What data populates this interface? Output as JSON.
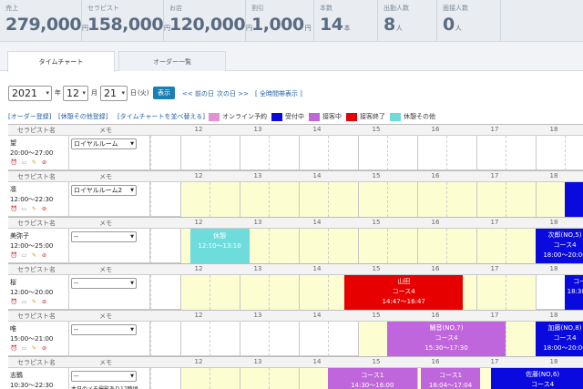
{
  "stats": [
    {
      "label": "売上",
      "value": "279,000",
      "unit": "円"
    },
    {
      "label": "セラピスト",
      "value": "158,000",
      "unit": "円"
    },
    {
      "label": "お店",
      "value": "120,000",
      "unit": "円"
    },
    {
      "label": "割引",
      "value": "1,000",
      "unit": "円"
    },
    {
      "label": "本数",
      "value": "14",
      "unit": "本"
    },
    {
      "label": "出勤人数",
      "value": "8",
      "unit": "人"
    },
    {
      "label": "面接人数",
      "value": "0",
      "unit": "人"
    }
  ],
  "tabs": {
    "timechart": "タイムチャート",
    "orders": "オーダー一覧"
  },
  "date": {
    "year": "2021",
    "year_suffix": "年",
    "month": "12",
    "month_suffix": "月",
    "day": "21",
    "day_suffix": "日",
    "weekday": "(火)",
    "show": "表示",
    "prev": "<< 前の日",
    "next": "次の日 >>",
    "all": "[ 全時間帯表示 ]"
  },
  "links": {
    "order_register": "[オーダー登録]",
    "break_register": "[休憩その他登録]",
    "sort": "[タイムチャートを並べ替える]"
  },
  "legend": [
    {
      "label": "オンライン予約",
      "color": "#e58fd6"
    },
    {
      "label": "受付中",
      "color": "#0a0adf"
    },
    {
      "label": "接客中",
      "color": "#c066dc"
    },
    {
      "label": "接客終了",
      "color": "#e60000"
    },
    {
      "label": "休憩その他",
      "color": "#6fdcdc"
    }
  ],
  "header": {
    "therapist": "セラピスト名",
    "memo": "メモ",
    "hours": [
      "12",
      "13",
      "14",
      "15",
      "16",
      "17",
      "18"
    ]
  },
  "rows": [
    {
      "name": "望",
      "time": "20:00〜27:00",
      "room": "ロイヤルルーム",
      "note": "",
      "avail": [],
      "blocks": []
    },
    {
      "name": "凛",
      "time": "12:00〜22:30",
      "room": "ロイヤルルーム2",
      "note": "",
      "avail": [
        [
          12,
          18.5
        ]
      ],
      "blocks": [
        {
          "s": 18.5,
          "e": 19,
          "color": "#0a0adf",
          "lines": []
        }
      ]
    },
    {
      "name": "美弥子",
      "time": "12:00〜25:00",
      "room": "--",
      "note": "",
      "avail": [
        [
          12,
          18
        ]
      ],
      "blocks": [
        {
          "s": 12.17,
          "e": 13.17,
          "color": "#6fdcdc",
          "lines": [
            "休憩",
            "12:10〜13:10"
          ]
        },
        {
          "s": 18,
          "e": 19,
          "color": "#0a0adf",
          "lines": [
            "次郎(NO,5)",
            "コース4",
            "18:00〜20:00"
          ]
        }
      ]
    },
    {
      "name": "桜",
      "time": "12:00〜20:00",
      "room": "--",
      "note": "",
      "avail": [
        [
          12,
          18
        ]
      ],
      "blocks": [
        {
          "s": 14.78,
          "e": 16.78,
          "color": "#e60000",
          "lines": [
            "山田",
            "コース4",
            "14:47〜16:47"
          ]
        },
        {
          "s": 18.5,
          "e": 19,
          "color": "#0a0adf",
          "lines": [
            "",
            "コー",
            "18:30〜"
          ]
        }
      ]
    },
    {
      "name": "唯",
      "time": "15:00〜21:00",
      "room": "--",
      "note": "",
      "avail": [
        [
          15,
          18
        ]
      ],
      "blocks": [
        {
          "s": 15.5,
          "e": 17.5,
          "color": "#c066dc",
          "lines": [
            "鯛音(NO,7)",
            "コース4",
            "15:30〜17:30"
          ]
        },
        {
          "s": 18,
          "e": 19,
          "color": "#0a0adf",
          "lines": [
            "加藤(NO,8)",
            "コース4",
            "18:00〜20:00"
          ]
        }
      ]
    },
    {
      "name": "志鶴",
      "time": "10:30〜22:30",
      "room": "--",
      "note": "本日のメモ撮影あり17時頃",
      "avail": [
        [
          12,
          19
        ]
      ],
      "blocks": [
        {
          "s": 14.5,
          "e": 16,
          "color": "#c066dc",
          "lines": [
            "コース1",
            "14:30〜16:00"
          ]
        },
        {
          "s": 16.07,
          "e": 17.07,
          "color": "#c066dc",
          "lines": [
            "コース1",
            "16:04〜17:04"
          ]
        },
        {
          "s": 17.25,
          "e": 19,
          "color": "#0a0adf",
          "lines": [
            "佐藤(NO,6)",
            "コース4",
            "17:15〜"
          ]
        }
      ]
    }
  ]
}
